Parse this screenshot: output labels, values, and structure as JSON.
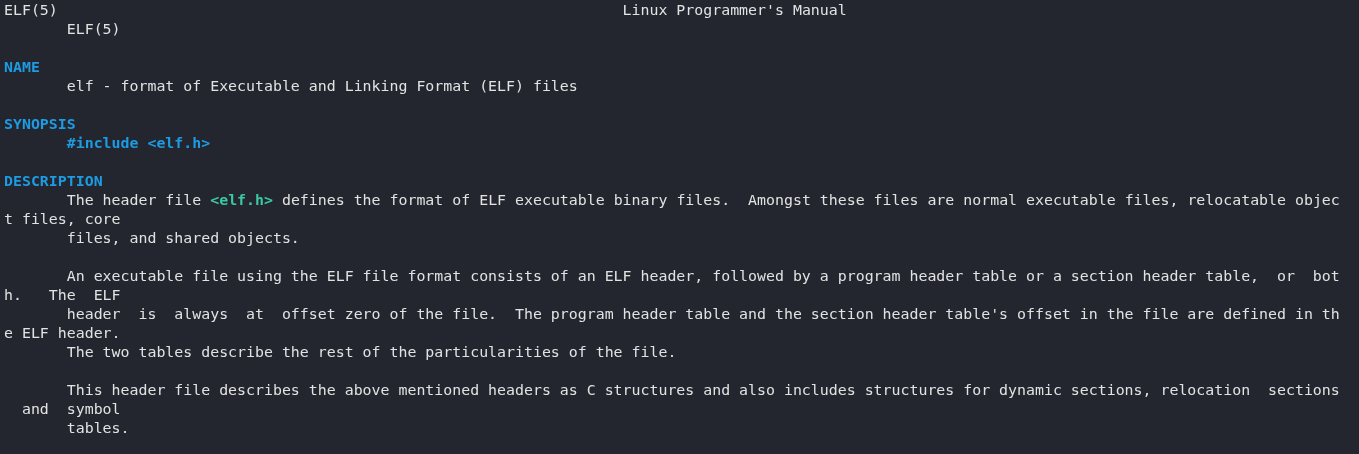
{
  "header": {
    "left": "ELF(5)",
    "center": "Linux Programmer's Manual",
    "right": "ELF(5)"
  },
  "blocks": [
    {
      "lines": [
        {
          "indent": false,
          "segments": [
            {
              "kind": "heading",
              "text": "NAME"
            }
          ]
        },
        {
          "indent": true,
          "segments": [
            {
              "kind": "text",
              "text": "elf - format of Executable and Linking Format (ELF) files"
            }
          ]
        }
      ]
    },
    {
      "lines": [
        {
          "indent": false,
          "segments": [
            {
              "kind": "heading",
              "text": "SYNOPSIS"
            }
          ]
        },
        {
          "indent": true,
          "segments": [
            {
              "kind": "code",
              "text": "#include <elf.h>"
            }
          ]
        }
      ]
    },
    {
      "lines": [
        {
          "indent": false,
          "segments": [
            {
              "kind": "heading",
              "text": "DESCRIPTION"
            }
          ]
        },
        {
          "indent": true,
          "segments": [
            {
              "kind": "text",
              "text": "The header file "
            },
            {
              "kind": "ref",
              "text": "<elf.h>"
            },
            {
              "kind": "text",
              "text": " defines the format of ELF executable binary files.  Amongst these files are normal executable files, relocatable objec"
            }
          ]
        },
        {
          "indent": false,
          "segments": [
            {
              "kind": "text",
              "text": "t files, core"
            }
          ]
        },
        {
          "indent": true,
          "segments": [
            {
              "kind": "text",
              "text": "files, and shared objects."
            }
          ]
        }
      ]
    },
    {
      "lines": [
        {
          "indent": true,
          "segments": [
            {
              "kind": "text",
              "text": "An executable file using the ELF file format consists of an ELF header, followed by a program header table or a section header table,  or  bot"
            }
          ]
        },
        {
          "indent": false,
          "segments": [
            {
              "kind": "text",
              "text": "h.   The  ELF"
            }
          ]
        },
        {
          "indent": true,
          "segments": [
            {
              "kind": "text",
              "text": "header  is  always  at  offset zero of the file.  The program header table and the section header table's offset in the file are defined in th"
            }
          ]
        },
        {
          "indent": false,
          "segments": [
            {
              "kind": "text",
              "text": "e ELF header."
            }
          ]
        },
        {
          "indent": true,
          "segments": [
            {
              "kind": "text",
              "text": "The two tables describe the rest of the particularities of the file."
            }
          ]
        }
      ]
    },
    {
      "lines": [
        {
          "indent": true,
          "segments": [
            {
              "kind": "text",
              "text": "This header file describes the above mentioned headers as C structures and also includes structures for dynamic sections, relocation  sections"
            }
          ]
        },
        {
          "indent": false,
          "segments": [
            {
              "kind": "text",
              "text": "  and  symbol"
            }
          ]
        },
        {
          "indent": true,
          "segments": [
            {
              "kind": "text",
              "text": "tables."
            }
          ]
        }
      ]
    }
  ]
}
